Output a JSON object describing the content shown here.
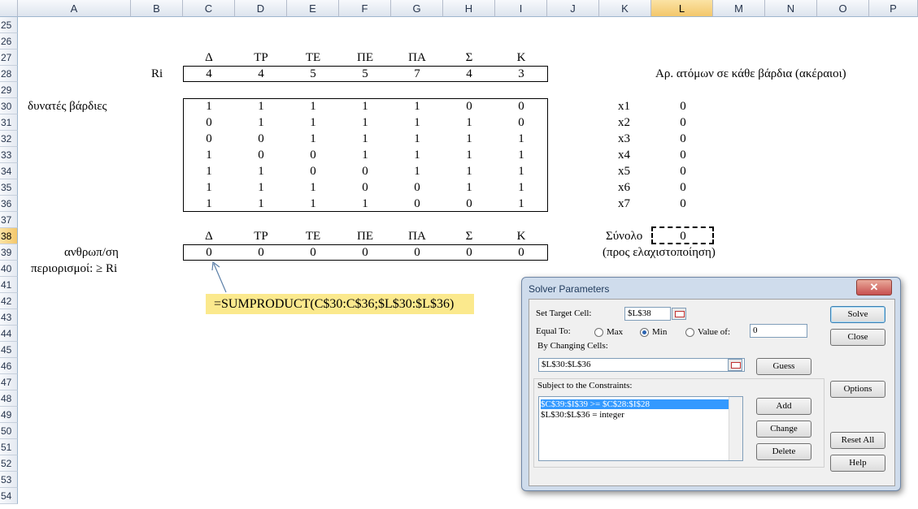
{
  "columns": [
    "A",
    "B",
    "C",
    "D",
    "E",
    "F",
    "G",
    "H",
    "I",
    "J",
    "K",
    "L",
    "M",
    "N",
    "O",
    "P"
  ],
  "selected_column": "L",
  "rows": [
    "25",
    "26",
    "27",
    "28",
    "29",
    "30",
    "31",
    "32",
    "33",
    "34",
    "35",
    "36",
    "37",
    "38",
    "39",
    "40",
    "41",
    "42",
    "43",
    "44",
    "45",
    "46",
    "47",
    "48",
    "49",
    "50",
    "51",
    "52",
    "53",
    "54"
  ],
  "selected_row": "38",
  "days": [
    "Δ",
    "ΤΡ",
    "ΤΕ",
    "ΠΕ",
    "ΠΑ",
    "Σ",
    "Κ"
  ],
  "ri_label": "Ri",
  "ri_values": [
    "4",
    "4",
    "5",
    "5",
    "7",
    "4",
    "3"
  ],
  "crew_note": "Αρ. ατόμων σε κάθε βάρδια (ακέραιοι)",
  "shifts_label": "δυνατές βάρδιες",
  "shift_matrix": [
    [
      "1",
      "1",
      "1",
      "1",
      "1",
      "0",
      "0"
    ],
    [
      "0",
      "1",
      "1",
      "1",
      "1",
      "1",
      "0"
    ],
    [
      "0",
      "0",
      "1",
      "1",
      "1",
      "1",
      "1"
    ],
    [
      "1",
      "0",
      "0",
      "1",
      "1",
      "1",
      "1"
    ],
    [
      "1",
      "1",
      "0",
      "0",
      "1",
      "1",
      "1"
    ],
    [
      "1",
      "1",
      "1",
      "0",
      "0",
      "1",
      "1"
    ],
    [
      "1",
      "1",
      "1",
      "1",
      "0",
      "0",
      "1"
    ]
  ],
  "var_names": [
    "x1",
    "x2",
    "x3",
    "x4",
    "x5",
    "x6",
    "x7"
  ],
  "var_values": [
    "0",
    "0",
    "0",
    "0",
    "0",
    "0",
    "0"
  ],
  "days2": [
    "Δ",
    "ΤΡ",
    "ΤΕ",
    "ΠΕ",
    "ΠΑ",
    "Σ",
    "Κ"
  ],
  "total_label": "Σύνολο",
  "total_value": "0",
  "minimize_note": "(προς ελαχιστοποίηση)",
  "people_label": "ανθρωπ/ση",
  "people_values": [
    "0",
    "0",
    "0",
    "0",
    "0",
    "0",
    "0"
  ],
  "constraints_label": "περιορισμοί: ≥ Ri",
  "formula": "=SUMPRODUCT(C$30:C$36;$L$30:$L$36)",
  "dialog": {
    "title": "Solver Parameters",
    "close": "✕",
    "set_target_label": "Set Target Cell:",
    "target_value": "$L$38",
    "equal_to_label": "Equal To:",
    "max_label": "Max",
    "min_label": "Min",
    "value_of_label": "Value of:",
    "value_of_value": "0",
    "changing_label": "By Changing Cells:",
    "changing_value": "$L$30:$L$36",
    "constraints_label": "Subject to the Constraints:",
    "constraints": [
      "$C$39:$I$39 >= $C$28:$I$28",
      "$L$30:$L$36 = integer"
    ],
    "buttons": {
      "solve": "Solve",
      "close": "Close",
      "guess": "Guess",
      "options": "Options",
      "add": "Add",
      "change": "Change",
      "delete": "Delete",
      "reset_all": "Reset All",
      "help": "Help"
    }
  }
}
